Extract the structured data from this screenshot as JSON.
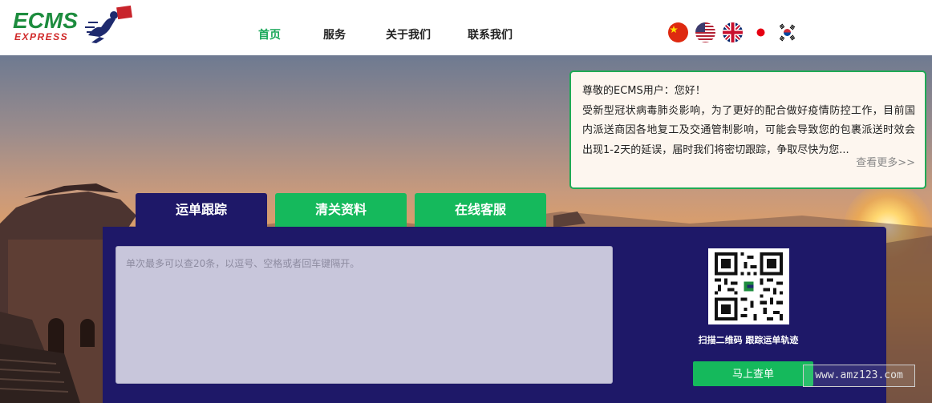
{
  "brand": {
    "logo_top": "ECMS",
    "logo_bottom": "EXPRESS"
  },
  "nav": [
    {
      "label": "首页",
      "active": true
    },
    {
      "label": "服务"
    },
    {
      "label": "关于我们"
    },
    {
      "label": "联系我们"
    }
  ],
  "languages": [
    "chinese-flag-icon",
    "usa-flag-icon",
    "uk-flag-icon",
    "japan-flag-icon",
    "korea-flag-icon"
  ],
  "notice": {
    "title": "尊敬的ECMS用户：您好！",
    "body": "受新型冠状病毒肺炎影响，为了更好的配合做好疫情防控工作，目前国内派送商因各地复工及交通管制影响，可能会导致您的包裹派送时效会出现1-2天的延误，届时我们将密切跟踪，争取尽快为您...",
    "more": "查看更多>>"
  },
  "tabs": [
    {
      "label": "运单跟踪",
      "active": true
    },
    {
      "label": "清关资料"
    },
    {
      "label": "在线客服"
    }
  ],
  "tracking": {
    "placeholder": "单次最多可以查20条，以逗号、空格或者回车键隔开。",
    "qr_caption": "扫描二维码 跟踪运单轨迹",
    "button": "马上查单"
  },
  "watermark": "www.amz123.com",
  "colors": {
    "accent_green": "#15b95c",
    "panel_navy": "#1e1868"
  }
}
